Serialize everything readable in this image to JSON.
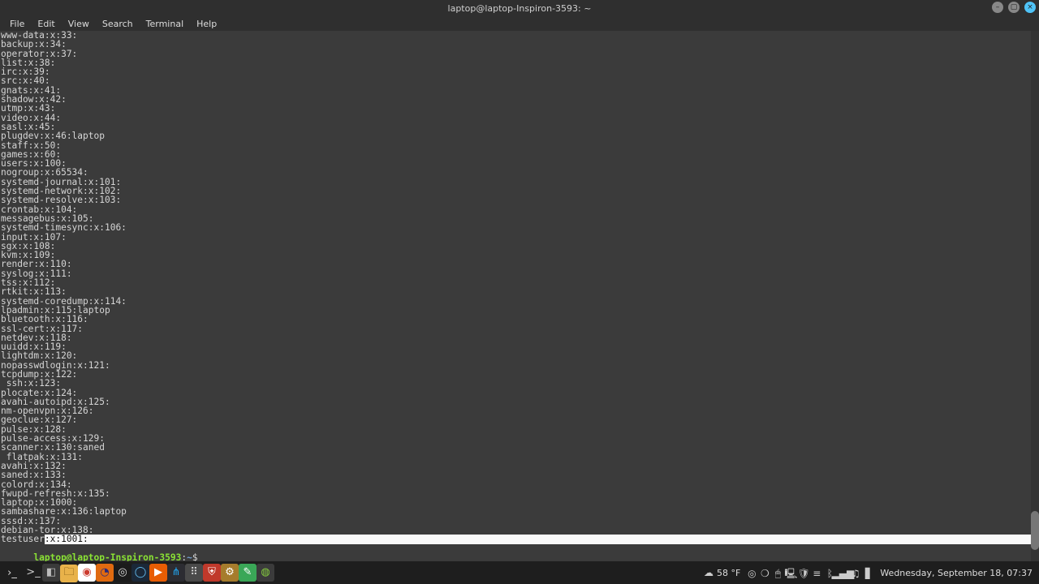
{
  "window": {
    "title": "laptop@laptop-Inspiron-3593: ~"
  },
  "menu": {
    "items": [
      "File",
      "Edit",
      "View",
      "Search",
      "Terminal",
      "Help"
    ]
  },
  "terminal": {
    "lines": [
      "www-data:x:33:",
      "backup:x:34:",
      "operator:x:37:",
      "list:x:38:",
      "irc:x:39:",
      "src:x:40:",
      "gnats:x:41:",
      "shadow:x:42:",
      "utmp:x:43:",
      "video:x:44:",
      "sasl:x:45:",
      "plugdev:x:46:laptop",
      "staff:x:50:",
      "games:x:60:",
      "users:x:100:",
      "nogroup:x:65534:",
      "systemd-journal:x:101:",
      "systemd-network:x:102:",
      "systemd-resolve:x:103:",
      "crontab:x:104:",
      "messagebus:x:105:",
      "systemd-timesync:x:106:",
      "input:x:107:",
      "sgx:x:108:",
      "kvm:x:109:",
      "render:x:110:",
      "syslog:x:111:",
      "tss:x:112:",
      "rtkit:x:113:",
      "systemd-coredump:x:114:",
      "lpadmin:x:115:laptop",
      "bluetooth:x:116:",
      "ssl-cert:x:117:",
      "netdev:x:118:",
      "uuidd:x:119:",
      "lightdm:x:120:",
      "nopasswdlogin:x:121:",
      "tcpdump:x:122:",
      " ssh:x:123:",
      "plocate:x:124:",
      "avahi-autoipd:x:125:",
      "nm-openvpn:x:126:",
      "geoclue:x:127:",
      "pulse:x:128:",
      "pulse-access:x:129:",
      "scanner:x:130:saned",
      " flatpak:x:131:",
      "avahi:x:132:",
      "saned:x:133:",
      "colord:x:134:",
      "fwupd-refresh:x:135:",
      "laptop:x:1000:",
      "sambashare:x:136:laptop",
      "sssd:x:137:",
      "debian-tor:x:138:"
    ],
    "highlighted_line_prefix": "testuser",
    "highlighted_line_suffix": ":x:1001:",
    "prompt": {
      "user": "laptop",
      "at": "@",
      "host": "laptop-Inspiron-3593",
      "colon": ":",
      "path": "~",
      "sigil": "$",
      "input": " "
    }
  },
  "panel": {
    "weather": {
      "icon": "☁",
      "temp": "58 °F"
    },
    "clock": "Wednesday, September 18, 07:37",
    "launchers": [
      {
        "name": "menu-icon",
        "glyph": ">_",
        "bg": "#1e1e1e",
        "fg": "#ccc"
      },
      {
        "name": "terminal-icon",
        "glyph": "◧",
        "bg": "#1e1e1e",
        "fg": "#bbb",
        "active_bg": "#3a3a3a"
      },
      {
        "name": "files-icon",
        "glyph": "🗀",
        "bg": "#e8b24a",
        "fg": "#5a3b00"
      },
      {
        "name": "chrome-icon",
        "glyph": "◉",
        "bg": "#ffffff",
        "fg": "#cc3b2e"
      },
      {
        "name": "firefox-icon",
        "glyph": "◔",
        "bg": "#e06a10",
        "fg": "#2a2a7a"
      },
      {
        "name": "obs-icon",
        "glyph": "◎",
        "bg": "#1b1b1b",
        "fg": "#ddd"
      },
      {
        "name": "steam-icon",
        "glyph": "◯",
        "bg": "#1b2838",
        "fg": "#66c0f4"
      },
      {
        "name": "vlc-icon",
        "glyph": "▶",
        "bg": "#e85d04",
        "fg": "#fff"
      },
      {
        "name": "vscode-icon",
        "glyph": "⋔",
        "bg": "#2c2c32",
        "fg": "#22a6f2"
      },
      {
        "name": "mpv-icon",
        "glyph": "⠿",
        "bg": "#4a4a4a",
        "fg": "#ddd"
      },
      {
        "name": "ublock-icon",
        "glyph": "⛨",
        "bg": "#c0392b",
        "fg": "#fff"
      },
      {
        "name": "software-icon",
        "glyph": "⚙",
        "bg": "#a67c2c",
        "fg": "#fff"
      },
      {
        "name": "text-editor-icon",
        "glyph": "✎",
        "bg": "#3aa757",
        "fg": "#fff"
      },
      {
        "name": "mint-icon",
        "glyph": "◍",
        "bg": "#3b3b3b",
        "fg": "#87cf3e"
      }
    ],
    "tray": [
      {
        "name": "obs-tray-icon",
        "glyph": "◎"
      },
      {
        "name": "steam-tray-icon",
        "glyph": "❍"
      },
      {
        "name": "mouse-tray-icon",
        "glyph": "🖱"
      },
      {
        "name": "touchpad-tray-icon",
        "glyph": "🖳"
      },
      {
        "name": "updates-tray-icon",
        "glyph": "🛡"
      },
      {
        "name": "menu-tray-icon",
        "glyph": "≡"
      },
      {
        "name": "bluetooth-tray-icon",
        "glyph": "ᛒ"
      },
      {
        "name": "network-tray-icon",
        "glyph": "▂▄▆"
      },
      {
        "name": "audio-tray-icon",
        "glyph": "♫"
      },
      {
        "name": "battery-tray-icon",
        "glyph": "▋"
      }
    ]
  }
}
